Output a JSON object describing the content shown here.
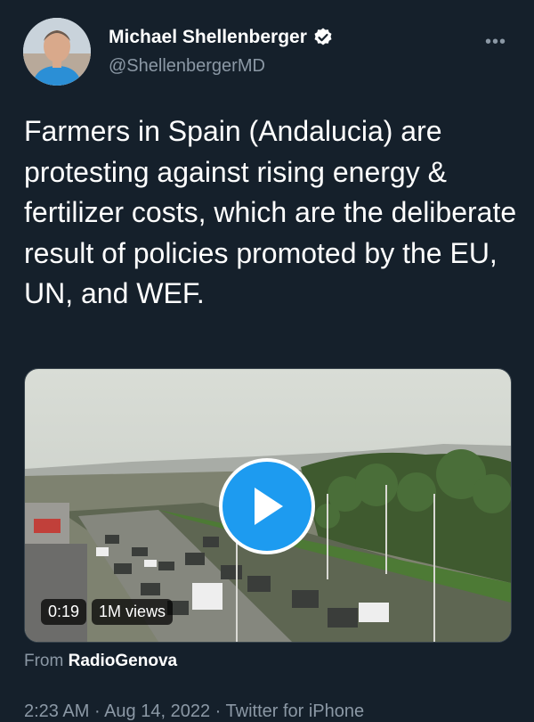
{
  "author": {
    "display_name": "Michael Shellenberger",
    "handle": "@ShellenbergerMD",
    "verified_icon": "verified-badge-icon",
    "more_label": "•••"
  },
  "tweet": {
    "text": "Farmers in Spain (Andalucia) are protesting against rising energy & fertilizer costs, which are the deliberate result of policies promoted by the EU, UN, and WEF."
  },
  "media": {
    "type": "video",
    "duration": "0:19",
    "views": "1M views",
    "play_icon": "play-icon"
  },
  "attribution": {
    "prefix": "From",
    "source": "RadioGenova"
  },
  "meta": {
    "time": "2:23 AM",
    "date": "Aug 14, 2022",
    "client": "Twitter for iPhone",
    "separator": "·"
  },
  "colors": {
    "background": "#15202b",
    "secondary_text": "#8b98a5",
    "accent": "#1d9bf0"
  }
}
